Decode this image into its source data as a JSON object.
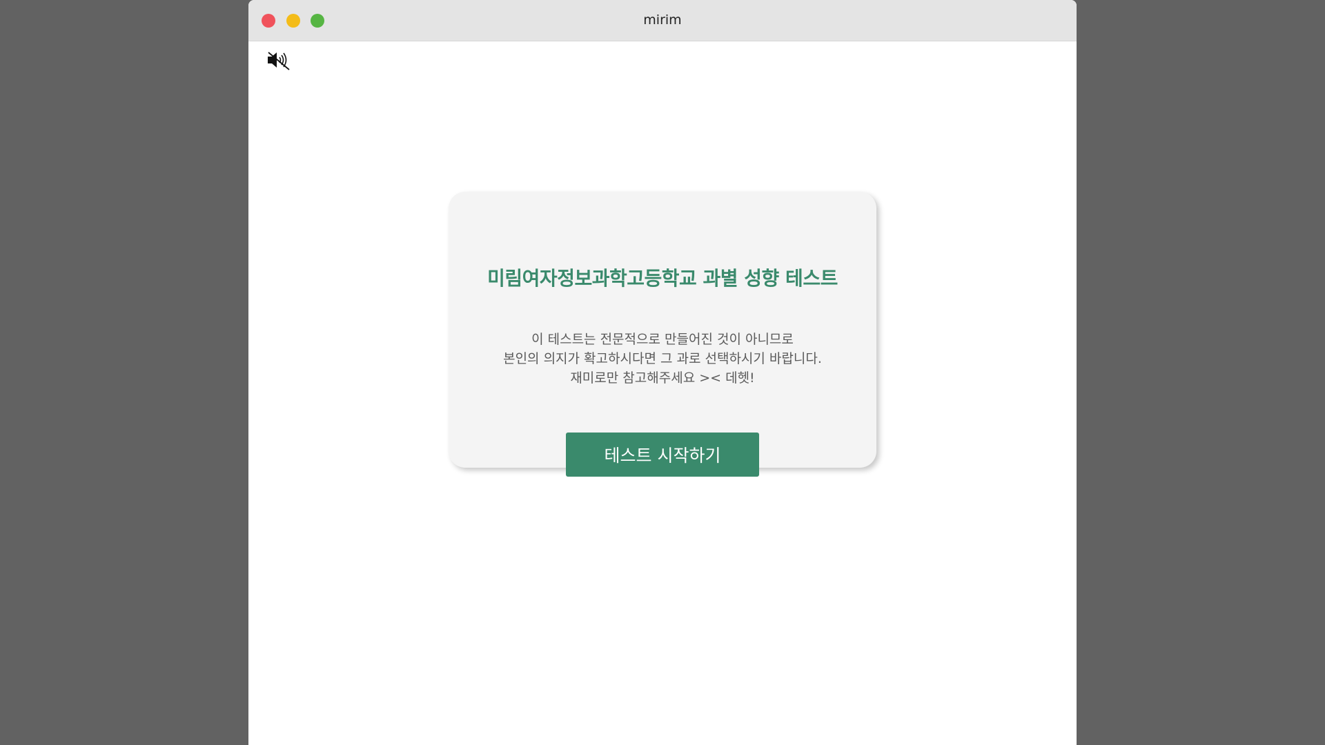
{
  "window": {
    "title": "mirim"
  },
  "colors": {
    "desktop": "#626262",
    "titlebar": "#e4e4e4",
    "close": "#f0525b",
    "minimize": "#f4bc19",
    "maximize": "#56b543",
    "accent": "#3a8a6c",
    "card_background": "#f4f4f4",
    "description_text": "#5a5a5a"
  },
  "toolbar": {
    "mute_icon": "speaker-muted-icon"
  },
  "card": {
    "title": "미림여자정보과학고등학교 과별 성향 테스트",
    "description_lines": [
      "이 테스트는 전문적으로 만들어진 것이 아니므로",
      "본인의 의지가 확고하시다면 그 과로 선택하시기 바랍니다.",
      "재미로만 참고해주세요 >< 데헷!"
    ],
    "start_button_label": "테스트 시작하기"
  }
}
